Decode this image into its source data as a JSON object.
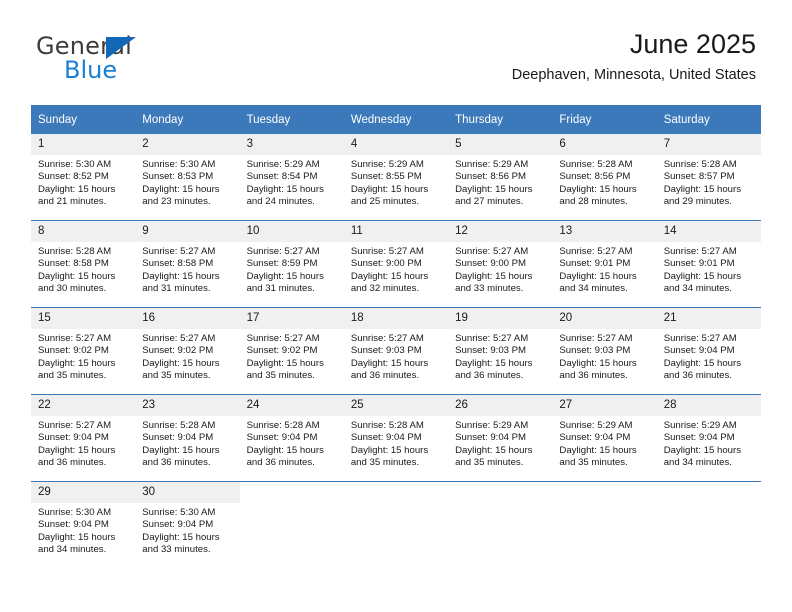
{
  "brand": {
    "name_part1": "General",
    "name_part2": "Blue",
    "triangle_color": "#1267b7",
    "blue_color": "#1b7fd4"
  },
  "header": {
    "title": "June 2025",
    "location": "Deephaven, Minnesota, United States"
  },
  "theme": {
    "header_bg": "#3c79ba",
    "daynum_bg": "#f0f0f0",
    "text": "#1a1a1a",
    "rule": "#3c79ba"
  },
  "weekdays": [
    "Sunday",
    "Monday",
    "Tuesday",
    "Wednesday",
    "Thursday",
    "Friday",
    "Saturday"
  ],
  "labels": {
    "sunrise_prefix": "Sunrise:",
    "sunset_prefix": "Sunset:",
    "daylight_prefix": "Daylight:"
  },
  "weeks": [
    [
      {
        "day": "1",
        "sunrise": "Sunrise: 5:30 AM",
        "sunset": "Sunset: 8:52 PM",
        "daylight_line1": "Daylight: 15 hours",
        "daylight_line2": "and 21 minutes."
      },
      {
        "day": "2",
        "sunrise": "Sunrise: 5:30 AM",
        "sunset": "Sunset: 8:53 PM",
        "daylight_line1": "Daylight: 15 hours",
        "daylight_line2": "and 23 minutes."
      },
      {
        "day": "3",
        "sunrise": "Sunrise: 5:29 AM",
        "sunset": "Sunset: 8:54 PM",
        "daylight_line1": "Daylight: 15 hours",
        "daylight_line2": "and 24 minutes."
      },
      {
        "day": "4",
        "sunrise": "Sunrise: 5:29 AM",
        "sunset": "Sunset: 8:55 PM",
        "daylight_line1": "Daylight: 15 hours",
        "daylight_line2": "and 25 minutes."
      },
      {
        "day": "5",
        "sunrise": "Sunrise: 5:29 AM",
        "sunset": "Sunset: 8:56 PM",
        "daylight_line1": "Daylight: 15 hours",
        "daylight_line2": "and 27 minutes."
      },
      {
        "day": "6",
        "sunrise": "Sunrise: 5:28 AM",
        "sunset": "Sunset: 8:56 PM",
        "daylight_line1": "Daylight: 15 hours",
        "daylight_line2": "and 28 minutes."
      },
      {
        "day": "7",
        "sunrise": "Sunrise: 5:28 AM",
        "sunset": "Sunset: 8:57 PM",
        "daylight_line1": "Daylight: 15 hours",
        "daylight_line2": "and 29 minutes."
      }
    ],
    [
      {
        "day": "8",
        "sunrise": "Sunrise: 5:28 AM",
        "sunset": "Sunset: 8:58 PM",
        "daylight_line1": "Daylight: 15 hours",
        "daylight_line2": "and 30 minutes."
      },
      {
        "day": "9",
        "sunrise": "Sunrise: 5:27 AM",
        "sunset": "Sunset: 8:58 PM",
        "daylight_line1": "Daylight: 15 hours",
        "daylight_line2": "and 31 minutes."
      },
      {
        "day": "10",
        "sunrise": "Sunrise: 5:27 AM",
        "sunset": "Sunset: 8:59 PM",
        "daylight_line1": "Daylight: 15 hours",
        "daylight_line2": "and 31 minutes."
      },
      {
        "day": "11",
        "sunrise": "Sunrise: 5:27 AM",
        "sunset": "Sunset: 9:00 PM",
        "daylight_line1": "Daylight: 15 hours",
        "daylight_line2": "and 32 minutes."
      },
      {
        "day": "12",
        "sunrise": "Sunrise: 5:27 AM",
        "sunset": "Sunset: 9:00 PM",
        "daylight_line1": "Daylight: 15 hours",
        "daylight_line2": "and 33 minutes."
      },
      {
        "day": "13",
        "sunrise": "Sunrise: 5:27 AM",
        "sunset": "Sunset: 9:01 PM",
        "daylight_line1": "Daylight: 15 hours",
        "daylight_line2": "and 34 minutes."
      },
      {
        "day": "14",
        "sunrise": "Sunrise: 5:27 AM",
        "sunset": "Sunset: 9:01 PM",
        "daylight_line1": "Daylight: 15 hours",
        "daylight_line2": "and 34 minutes."
      }
    ],
    [
      {
        "day": "15",
        "sunrise": "Sunrise: 5:27 AM",
        "sunset": "Sunset: 9:02 PM",
        "daylight_line1": "Daylight: 15 hours",
        "daylight_line2": "and 35 minutes."
      },
      {
        "day": "16",
        "sunrise": "Sunrise: 5:27 AM",
        "sunset": "Sunset: 9:02 PM",
        "daylight_line1": "Daylight: 15 hours",
        "daylight_line2": "and 35 minutes."
      },
      {
        "day": "17",
        "sunrise": "Sunrise: 5:27 AM",
        "sunset": "Sunset: 9:02 PM",
        "daylight_line1": "Daylight: 15 hours",
        "daylight_line2": "and 35 minutes."
      },
      {
        "day": "18",
        "sunrise": "Sunrise: 5:27 AM",
        "sunset": "Sunset: 9:03 PM",
        "daylight_line1": "Daylight: 15 hours",
        "daylight_line2": "and 36 minutes."
      },
      {
        "day": "19",
        "sunrise": "Sunrise: 5:27 AM",
        "sunset": "Sunset: 9:03 PM",
        "daylight_line1": "Daylight: 15 hours",
        "daylight_line2": "and 36 minutes."
      },
      {
        "day": "20",
        "sunrise": "Sunrise: 5:27 AM",
        "sunset": "Sunset: 9:03 PM",
        "daylight_line1": "Daylight: 15 hours",
        "daylight_line2": "and 36 minutes."
      },
      {
        "day": "21",
        "sunrise": "Sunrise: 5:27 AM",
        "sunset": "Sunset: 9:04 PM",
        "daylight_line1": "Daylight: 15 hours",
        "daylight_line2": "and 36 minutes."
      }
    ],
    [
      {
        "day": "22",
        "sunrise": "Sunrise: 5:27 AM",
        "sunset": "Sunset: 9:04 PM",
        "daylight_line1": "Daylight: 15 hours",
        "daylight_line2": "and 36 minutes."
      },
      {
        "day": "23",
        "sunrise": "Sunrise: 5:28 AM",
        "sunset": "Sunset: 9:04 PM",
        "daylight_line1": "Daylight: 15 hours",
        "daylight_line2": "and 36 minutes."
      },
      {
        "day": "24",
        "sunrise": "Sunrise: 5:28 AM",
        "sunset": "Sunset: 9:04 PM",
        "daylight_line1": "Daylight: 15 hours",
        "daylight_line2": "and 36 minutes."
      },
      {
        "day": "25",
        "sunrise": "Sunrise: 5:28 AM",
        "sunset": "Sunset: 9:04 PM",
        "daylight_line1": "Daylight: 15 hours",
        "daylight_line2": "and 35 minutes."
      },
      {
        "day": "26",
        "sunrise": "Sunrise: 5:29 AM",
        "sunset": "Sunset: 9:04 PM",
        "daylight_line1": "Daylight: 15 hours",
        "daylight_line2": "and 35 minutes."
      },
      {
        "day": "27",
        "sunrise": "Sunrise: 5:29 AM",
        "sunset": "Sunset: 9:04 PM",
        "daylight_line1": "Daylight: 15 hours",
        "daylight_line2": "and 35 minutes."
      },
      {
        "day": "28",
        "sunrise": "Sunrise: 5:29 AM",
        "sunset": "Sunset: 9:04 PM",
        "daylight_line1": "Daylight: 15 hours",
        "daylight_line2": "and 34 minutes."
      }
    ],
    [
      {
        "day": "29",
        "sunrise": "Sunrise: 5:30 AM",
        "sunset": "Sunset: 9:04 PM",
        "daylight_line1": "Daylight: 15 hours",
        "daylight_line2": "and 34 minutes."
      },
      {
        "day": "30",
        "sunrise": "Sunrise: 5:30 AM",
        "sunset": "Sunset: 9:04 PM",
        "daylight_line1": "Daylight: 15 hours",
        "daylight_line2": "and 33 minutes."
      },
      {
        "day": "",
        "sunrise": "",
        "sunset": "",
        "daylight_line1": "",
        "daylight_line2": ""
      },
      {
        "day": "",
        "sunrise": "",
        "sunset": "",
        "daylight_line1": "",
        "daylight_line2": ""
      },
      {
        "day": "",
        "sunrise": "",
        "sunset": "",
        "daylight_line1": "",
        "daylight_line2": ""
      },
      {
        "day": "",
        "sunrise": "",
        "sunset": "",
        "daylight_line1": "",
        "daylight_line2": ""
      },
      {
        "day": "",
        "sunrise": "",
        "sunset": "",
        "daylight_line1": "",
        "daylight_line2": ""
      }
    ]
  ]
}
